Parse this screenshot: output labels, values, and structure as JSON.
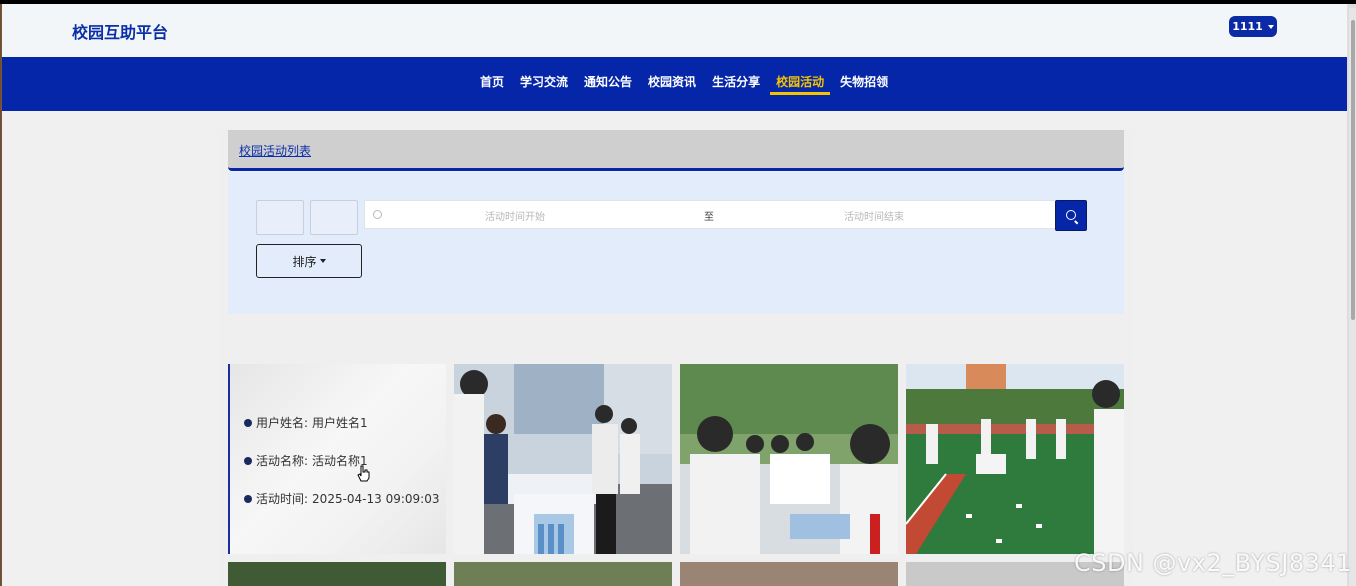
{
  "site": {
    "title": "校园互助平台"
  },
  "user": {
    "name": "1111"
  },
  "nav": {
    "items": [
      {
        "label": "首页"
      },
      {
        "label": "学习交流"
      },
      {
        "label": "通知公告"
      },
      {
        "label": "校园资讯"
      },
      {
        "label": "生活分享"
      },
      {
        "label": "校园活动",
        "active": true
      },
      {
        "label": "失物招领"
      }
    ]
  },
  "list": {
    "header": "校园活动列表"
  },
  "filters": {
    "date_start_placeholder": "活动时间开始",
    "date_separator": "至",
    "date_end_placeholder": "活动时间结束",
    "sort_label": "排序"
  },
  "activity": {
    "user_name_label": "用户姓名:",
    "user_name_value": "用户姓名1",
    "activity_name_label": "活动名称:",
    "activity_name_value": "活动名称1",
    "activity_time_label": "活动时间:",
    "activity_time_value": "2025-04-13 09:09:03"
  },
  "watermark": "CSDN @vx2_BYSJ8341",
  "colors": {
    "primary": "#0526a8",
    "accent": "#f4c400",
    "panel": "#e3ecfb"
  }
}
